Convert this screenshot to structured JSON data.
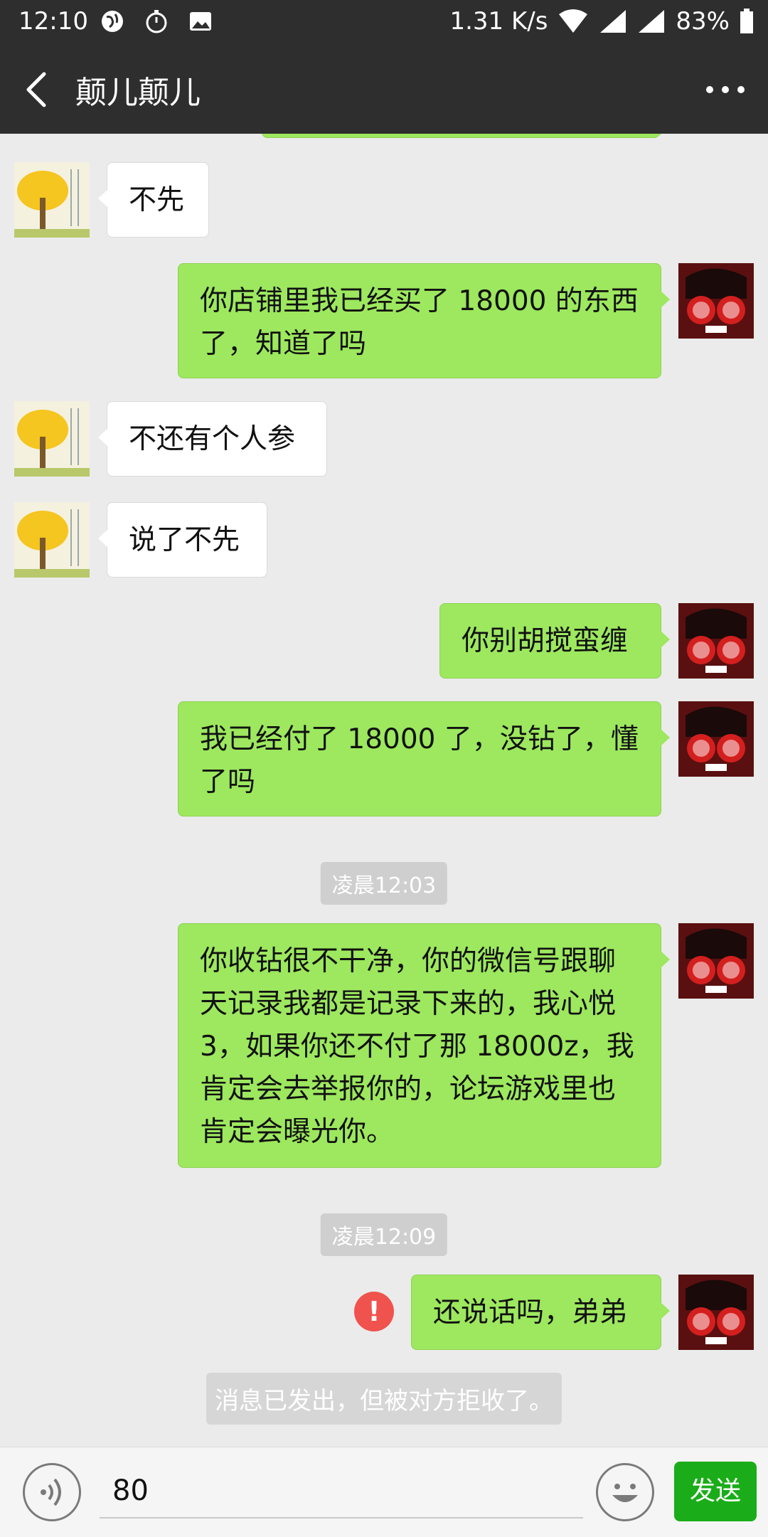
{
  "status_bar": {
    "time": "12:10",
    "net_speed": "1.31 K/s",
    "battery": "83%"
  },
  "header": {
    "title": "颠儿颠儿"
  },
  "messages": [
    {
      "side": "in",
      "text": "不先"
    },
    {
      "side": "out",
      "text": "你店铺里我已经买了 18000 的东西了，知道了吗"
    },
    {
      "side": "in",
      "text": "不还有个人参"
    },
    {
      "side": "in",
      "text": "说了不先"
    },
    {
      "side": "out",
      "text": "你别胡搅蛮缠"
    },
    {
      "side": "out",
      "text": "我已经付了 18000 了，没钻了，懂了吗"
    },
    {
      "side": "time",
      "text": "凌晨12:03"
    },
    {
      "side": "out",
      "text": "你收钻很不干净，你的微信号跟聊天记录我都是记录下来的，我心悦3，如果你还不付了那 18000z，我肯定会去举报你的，论坛游戏里也肯定会曝光你。"
    },
    {
      "side": "time",
      "text": "凌晨12:09"
    },
    {
      "side": "out",
      "text": "还说话吗，弟弟",
      "error": true
    },
    {
      "side": "notice",
      "text": "消息已发出，但被对方拒收了。"
    }
  ],
  "input": {
    "value": "80",
    "send_label": "发送"
  },
  "colors": {
    "outgoing_bubble": "#9de85e",
    "send_button": "#1aad19",
    "error": "#f0524d"
  },
  "icons": {
    "back": "back-arrow-icon",
    "more": "more-dots-icon",
    "voice": "voice-icon",
    "emoji": "emoji-icon",
    "error": "exclamation-icon"
  }
}
